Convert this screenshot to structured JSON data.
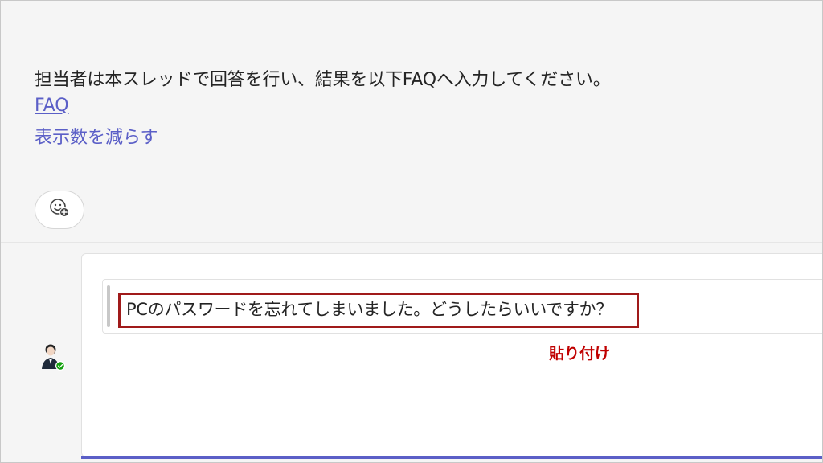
{
  "post": {
    "message": "担当者は本スレッドで回答を行い、結果を以下FAQへ入力してください。",
    "faq_link": "FAQ",
    "show_less": "表示数を減らす"
  },
  "reaction_icon": "emoji-add-icon",
  "reply": {
    "quoted_text": "PCのパスワードを忘れてしまいました。どうしたらいいですか？",
    "annotation": "貼り付け"
  },
  "colors": {
    "link": "#5b5fc7",
    "highlight_border": "#a01a1a",
    "annotation": "#c00000",
    "compose_accent": "#5b5fc7",
    "presence_available": "#13a10e"
  }
}
